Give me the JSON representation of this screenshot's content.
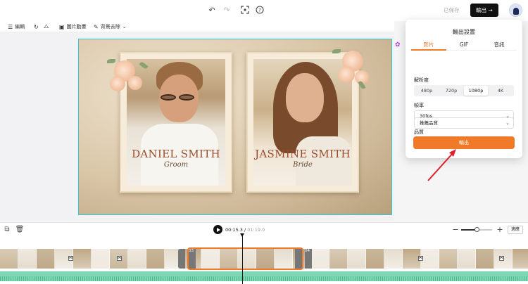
{
  "topbar": {
    "undo_icon": "undo-icon",
    "redo_icon": "redo-icon",
    "saved_label": "已保存",
    "export_label": "輸出",
    "export_arrow": "→"
  },
  "toolbar": {
    "edit_label": "編輯",
    "pip_label": "圖片動畫",
    "remove_bg_label": "背景去除"
  },
  "canvas": {
    "left_name": "DANIEL SMITH",
    "left_role": "Groom",
    "right_name": "JASMINE SMITH",
    "right_role": "Bride"
  },
  "export_panel": {
    "title": "輸出設置",
    "tabs": [
      {
        "label": "影片",
        "active": true
      },
      {
        "label": "GIF",
        "active": false
      },
      {
        "label": "音訊",
        "active": false
      }
    ],
    "resolution_label": "解析度",
    "resolutions": [
      "480p",
      "720p",
      "1080p",
      "4K"
    ],
    "selected_resolution": "1080p",
    "fps_label": "幀率",
    "fps_value": "30fps",
    "quality_label": "品質",
    "quality_value": "推薦品質",
    "export_button": "輸出"
  },
  "playback": {
    "current_time": "00:15.3",
    "separator": " / ",
    "duration": "01:19.0",
    "zoom_level": 0.5,
    "fit_label": "適應"
  },
  "timeline": {
    "clip_tags": [
      "03",
      "04"
    ]
  },
  "colors": {
    "accent": "#f07a28",
    "canvas_border": "#31c8d6",
    "audio_track": "#7fd8b5",
    "annotation_arrow": "#e0202a"
  }
}
